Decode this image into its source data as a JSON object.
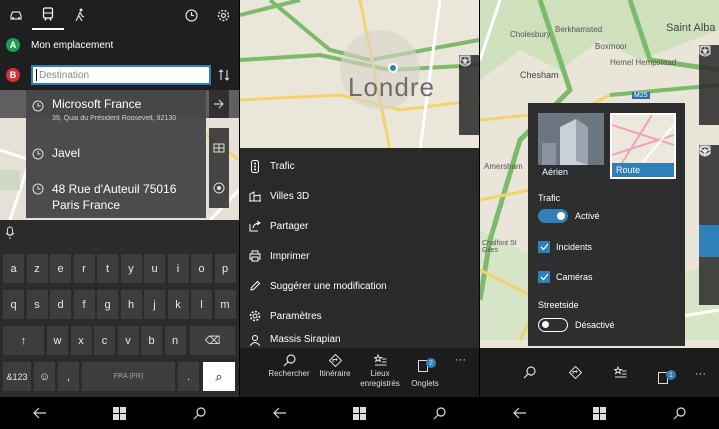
{
  "p1": {
    "top_icons": [
      "car-icon",
      "bus-icon",
      "walk-icon",
      "clock-icon",
      "gear-icon"
    ],
    "start_badge": "A",
    "start_label": "Mon emplacement",
    "dest_badge": "B",
    "dest_placeholder": "Destination",
    "suggestions": [
      {
        "title": "Microsoft France",
        "subtitle": "39, Quai du Président Roosevelt, 92130"
      },
      {
        "title": "Javel",
        "subtitle": ""
      },
      {
        "title": "48 Rue d'Auteuil 75016 Paris France",
        "subtitle": ""
      }
    ],
    "keyboard": {
      "row1": [
        "a",
        "z",
        "e",
        "r",
        "t",
        "y",
        "u",
        "i",
        "o",
        "p"
      ],
      "row2": [
        "q",
        "s",
        "d",
        "f",
        "g",
        "h",
        "j",
        "k",
        "l",
        "m"
      ],
      "row3": [
        "w",
        "x",
        "c",
        "v",
        "b",
        "n"
      ],
      "shift": "↑",
      "backspace": "⌫",
      "num_key": "&123",
      "emoji_key": "☺",
      "comma_key": ",",
      "space_label": "FRA (FR)",
      "period_key": ".",
      "search_key": "⌕"
    }
  },
  "p2": {
    "map_label": "Londre",
    "menu_items": [
      {
        "label": "Trafic",
        "icon": "traffic-icon"
      },
      {
        "label": "Villes 3D",
        "icon": "buildings-icon"
      },
      {
        "label": "Partager",
        "icon": "share-icon"
      },
      {
        "label": "Imprimer",
        "icon": "print-icon"
      },
      {
        "label": "Suggérer une modification",
        "icon": "edit-icon"
      },
      {
        "label": "Paramètres",
        "icon": "gear-icon"
      },
      {
        "label": "Massis Sirapian",
        "icon": "user-icon"
      }
    ],
    "appbar": [
      {
        "label": "Rechercher",
        "icon": "search-icon"
      },
      {
        "label": "Itinéraire",
        "icon": "directions-icon"
      },
      {
        "label": "Lieux enregistrés",
        "icon": "favorites-icon"
      },
      {
        "label": "Onglets",
        "icon": "tabs-icon",
        "badge": "2"
      }
    ],
    "more": "···"
  },
  "p3": {
    "place_labels": [
      "Saint Alba",
      "Chesham",
      "Cholesbury",
      "Berkhamsted",
      "Boxmoor",
      "Hemel Hempstead",
      "M25",
      "Amersham",
      "Chalfont St Giles"
    ],
    "layers": {
      "aerial_label": "Aérien",
      "road_label": "Route",
      "traffic_title": "Trafic",
      "traffic_toggle_label": "Activé",
      "incidents_label": "Incidents",
      "cameras_label": "Caméras",
      "streetside_title": "Streetside",
      "streetside_toggle_label": "Désactivé"
    },
    "tabs_badge": "1",
    "more": "···"
  },
  "colors": {
    "accent": "#2f7fb8",
    "start": "#1f9d55",
    "dest": "#d13438"
  }
}
